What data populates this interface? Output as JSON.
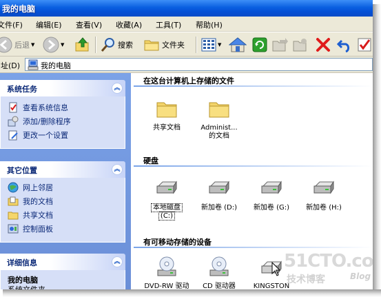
{
  "window": {
    "title": "我的电脑"
  },
  "menu": [
    {
      "label": "文件(F)"
    },
    {
      "label": "编辑(E)"
    },
    {
      "label": "查看(V)"
    },
    {
      "label": "收藏(A)"
    },
    {
      "label": "工具(T)"
    },
    {
      "label": "帮助(H)"
    }
  ],
  "toolbar": {
    "back_label": "后退",
    "search_label": "搜索",
    "folders_label": "文件夹"
  },
  "address": {
    "label": "址(D)",
    "value": "我的电脑"
  },
  "taskpane": {
    "system_tasks": {
      "title": "系统任务",
      "items": [
        "查看系统信息",
        "添加/删除程序",
        "更改一个设置"
      ]
    },
    "other_places": {
      "title": "其它位置",
      "items": [
        "网上邻居",
        "我的文档",
        "共享文档",
        "控制面板"
      ]
    },
    "details": {
      "title": "详细信息",
      "name": "我的电脑",
      "sub": "系统文件夹"
    }
  },
  "content": {
    "stored_files": {
      "title": "在这台计算机上存储的文件",
      "items": [
        {
          "line1": "共享文档",
          "line2": ""
        },
        {
          "line1": "Administ...",
          "line2": "的文档"
        }
      ]
    },
    "hard_disks": {
      "title": "硬盘",
      "items": [
        {
          "line1": "本地磁盘",
          "line2": "(C:)"
        },
        {
          "line1": "新加卷 (D:)",
          "line2": ""
        },
        {
          "line1": "新加卷 (G:)",
          "line2": ""
        },
        {
          "line1": "新加卷 (H:)",
          "line2": ""
        }
      ]
    },
    "removable": {
      "title": "有可移动存储的设备",
      "items": [
        {
          "line1": "DVD-RW 驱动"
        },
        {
          "line1": "CD 驱动器"
        },
        {
          "line1": "KINGSTON"
        }
      ]
    }
  },
  "watermark": {
    "main": "51CTO.com",
    "sub": "技术博客",
    "blog": "Blog"
  },
  "colors": {
    "titlebar": "#0550d6",
    "taskpane": "#7ba2e7",
    "panel_body": "#d6dff7",
    "panel_title": "#215dc6"
  }
}
